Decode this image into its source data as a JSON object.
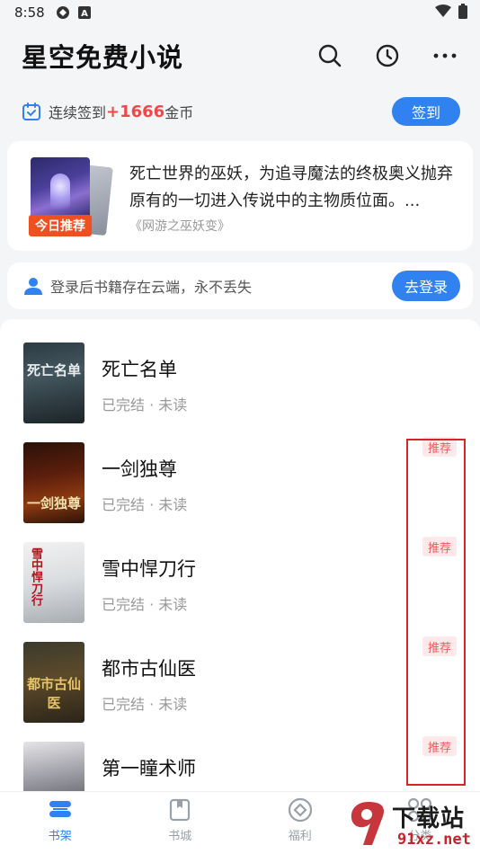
{
  "status_bar": {
    "time": "8:58"
  },
  "header": {
    "title": "星空免费小说"
  },
  "checkin": {
    "prefix": "连续签到",
    "coins": "+1666",
    "suffix": "金币",
    "button": "签到"
  },
  "recommend": {
    "badge": "今日推荐",
    "description": "死亡世界的巫妖，为追寻魔法的终极奥义抛弃原有的一切进入传说中的主物质位面。...",
    "book": "《网游之巫妖变》"
  },
  "login": {
    "text": "登录后书籍存在云端，永不丢失",
    "button": "去登录"
  },
  "books": [
    {
      "title": "死亡名单",
      "status": "已完结 · 未读",
      "tag": "",
      "cover_text": "死亡名单"
    },
    {
      "title": "一剑独尊",
      "status": "已完结 · 未读",
      "tag": "推荐",
      "cover_text": "一剑独尊"
    },
    {
      "title": "雪中悍刀行",
      "status": "已完结 · 未读",
      "tag": "推荐",
      "cover_text": "雪中悍刀行"
    },
    {
      "title": "都市古仙医",
      "status": "已完结 · 未读",
      "tag": "推荐",
      "cover_text": "都市古仙医"
    },
    {
      "title": "第一瞳术师",
      "status": "",
      "tag": "推荐",
      "cover_text": ""
    }
  ],
  "bottom_nav": [
    {
      "label": "书架",
      "icon": "bookshelf-icon",
      "active": true
    },
    {
      "label": "书城",
      "icon": "bookstore-icon",
      "active": false
    },
    {
      "label": "福利",
      "icon": "welfare-icon",
      "active": false
    },
    {
      "label": "分类",
      "icon": "category-icon",
      "active": false
    }
  ],
  "watermark": {
    "text": "下载站",
    "domain": "91xz.net"
  },
  "colors": {
    "accent": "#2f82f0",
    "coins": "#f04848",
    "badge": "#f0501f",
    "tag": "#f05a5a",
    "highlight": "#d9232a"
  }
}
